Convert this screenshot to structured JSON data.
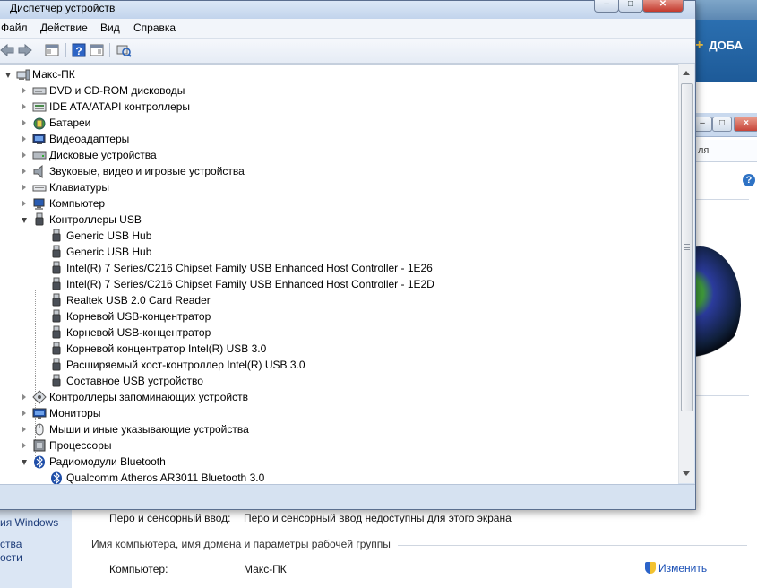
{
  "background": {
    "add_label": "ДОБА",
    "sidebar_links": [
      "ия Windows",
      "ства",
      "ости"
    ],
    "side_window": {
      "address_text": "ля",
      "help": "?"
    },
    "pen_touch": {
      "label": "Перо и сенсорный ввод:",
      "value": "Перо и сенсорный ввод недоступны для этого экрана"
    },
    "section_heading": "Имя компьютера, имя домена и параметры рабочей группы",
    "computer": {
      "label": "Компьютер:",
      "value": "Макс-ПК"
    },
    "change_link": "Изменить"
  },
  "device_manager": {
    "title": "Диспетчер устройств",
    "menu": [
      "Файл",
      "Действие",
      "Вид",
      "Справка"
    ],
    "toolbar": [
      "back-icon",
      "forward-icon",
      "properties-icon",
      "help-icon",
      "view-icon",
      "scan-hardware-icon"
    ],
    "tree": [
      {
        "label": "Макс-ПК",
        "level": 0,
        "state": "open",
        "icon": "computer-root-icon"
      },
      {
        "label": "DVD и CD-ROM дисководы",
        "level": 1,
        "state": "closed",
        "icon": "dvd-drive-icon"
      },
      {
        "label": "IDE ATA/ATAPI контроллеры",
        "level": 1,
        "state": "closed",
        "icon": "ide-controller-icon"
      },
      {
        "label": "Батареи",
        "level": 1,
        "state": "closed",
        "icon": "battery-icon"
      },
      {
        "label": "Видеоадаптеры",
        "level": 1,
        "state": "closed",
        "icon": "display-adapter-icon"
      },
      {
        "label": "Дисковые устройства",
        "level": 1,
        "state": "closed",
        "icon": "disk-drive-icon"
      },
      {
        "label": "Звуковые, видео и игровые устройства",
        "level": 1,
        "state": "closed",
        "icon": "sound-icon"
      },
      {
        "label": "Клавиатуры",
        "level": 1,
        "state": "closed",
        "icon": "keyboard-icon"
      },
      {
        "label": "Компьютер",
        "level": 1,
        "state": "closed",
        "icon": "computer-icon"
      },
      {
        "label": "Контроллеры USB",
        "level": 1,
        "state": "open",
        "icon": "usb-icon"
      },
      {
        "label": "Generic USB Hub",
        "level": 2,
        "state": "leaf",
        "icon": "usb-icon"
      },
      {
        "label": "Generic USB Hub",
        "level": 2,
        "state": "leaf",
        "icon": "usb-icon"
      },
      {
        "label": "Intel(R) 7 Series/C216 Chipset Family USB Enhanced Host Controller - 1E26",
        "level": 2,
        "state": "leaf",
        "icon": "usb-icon"
      },
      {
        "label": "Intel(R) 7 Series/C216 Chipset Family USB Enhanced Host Controller - 1E2D",
        "level": 2,
        "state": "leaf",
        "icon": "usb-icon"
      },
      {
        "label": "Realtek USB 2.0 Card Reader",
        "level": 2,
        "state": "leaf",
        "icon": "usb-icon"
      },
      {
        "label": "Корневой USB-концентратор",
        "level": 2,
        "state": "leaf",
        "icon": "usb-icon"
      },
      {
        "label": "Корневой USB-концентратор",
        "level": 2,
        "state": "leaf",
        "icon": "usb-icon"
      },
      {
        "label": "Корневой концентратор Intel(R) USB 3.0",
        "level": 2,
        "state": "leaf",
        "icon": "usb-icon"
      },
      {
        "label": "Расширяемый хост-контроллер Intel(R) USB 3.0",
        "level": 2,
        "state": "leaf",
        "icon": "usb-icon"
      },
      {
        "label": "Составное USB устройство",
        "level": 2,
        "state": "leaf",
        "icon": "usb-icon"
      },
      {
        "label": "Контроллеры запоминающих устройств",
        "level": 1,
        "state": "closed",
        "icon": "storage-controller-icon"
      },
      {
        "label": "Мониторы",
        "level": 1,
        "state": "closed",
        "icon": "monitor-icon"
      },
      {
        "label": "Мыши и иные указывающие устройства",
        "level": 1,
        "state": "closed",
        "icon": "mouse-icon"
      },
      {
        "label": "Процессоры",
        "level": 1,
        "state": "closed",
        "icon": "processor-icon"
      },
      {
        "label": "Радиомодули Bluetooth",
        "level": 1,
        "state": "open",
        "icon": "bluetooth-icon"
      },
      {
        "label": "Qualcomm Atheros AR3011 Bluetooth 3.0",
        "level": 2,
        "state": "leaf",
        "icon": "bluetooth-icon"
      }
    ]
  },
  "colors": {
    "accent": "#1d5a98",
    "link": "#1a4fb5",
    "window_frame": "#d6e2f1"
  }
}
